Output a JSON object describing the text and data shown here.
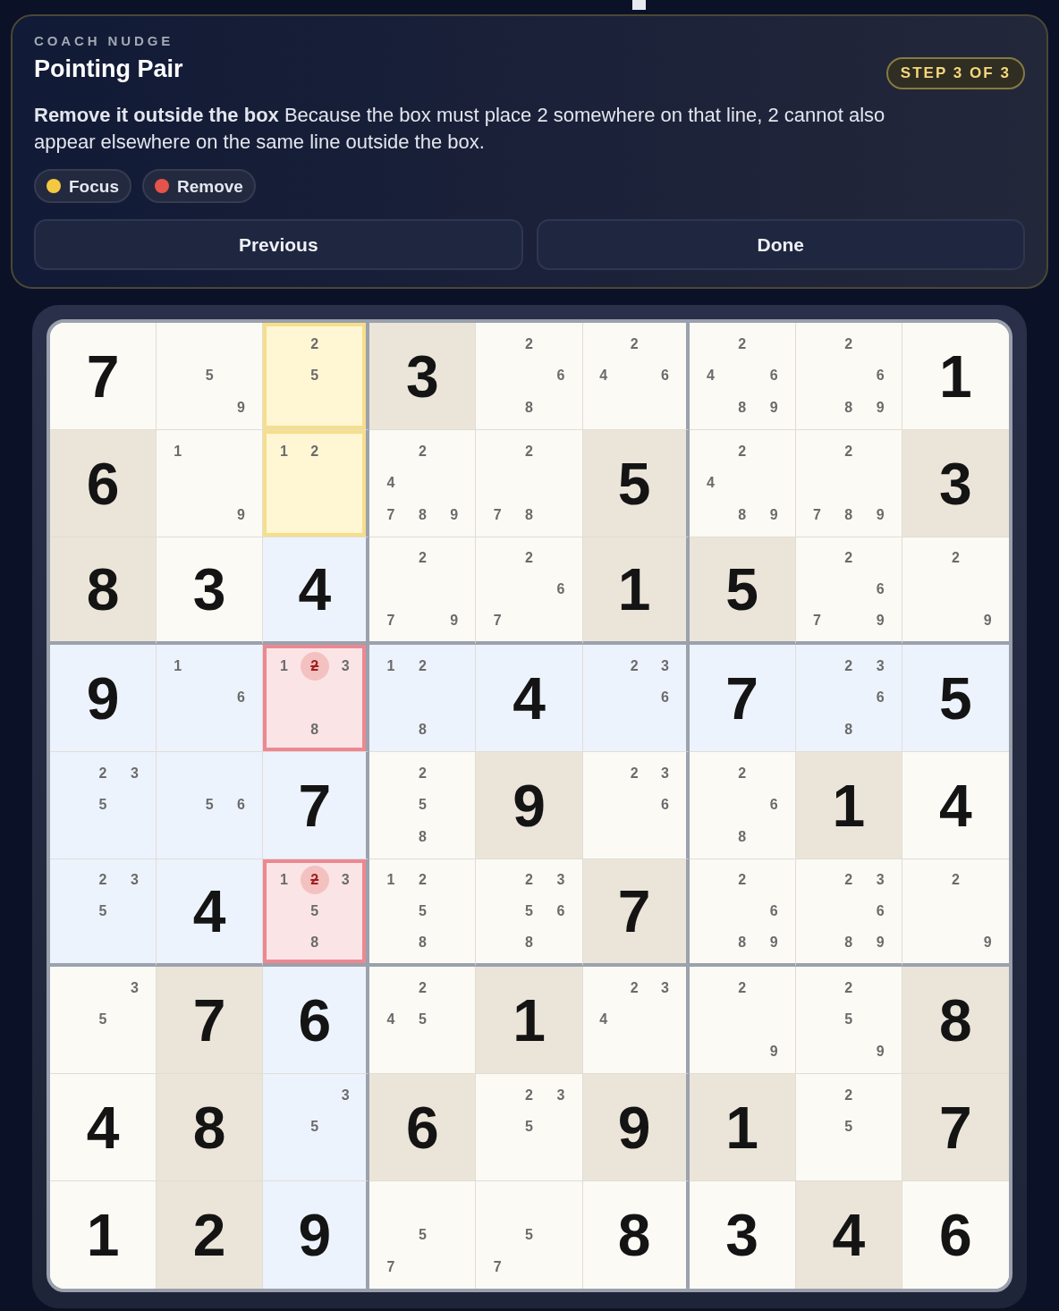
{
  "header": {
    "eyebrow": "COACH NUDGE",
    "title": "Pointing Pair",
    "step_badge": "STEP 3 OF 3"
  },
  "message": "**Remove it outside the box** Because the box must place 2 somewhere on that line, 2 cannot also appear elsewhere on the same line outside the box.",
  "legend": [
    {
      "label": "Focus",
      "color": "#f5c842"
    },
    {
      "label": "Remove",
      "color": "#e5534b"
    }
  ],
  "buttons": [
    {
      "label": "Previous"
    },
    {
      "label": "Done"
    }
  ],
  "board": {
    "rows": [
      [
        {
          "value": "7",
          "kind": "plain"
        },
        {
          "notes": [
            "5",
            "9"
          ],
          "kind": "plain"
        },
        {
          "notes": [
            "2",
            "5"
          ],
          "kind": "focus"
        },
        {
          "value": "3",
          "kind": "given"
        },
        {
          "notes": [
            "2",
            "6",
            "8"
          ],
          "kind": "plain"
        },
        {
          "notes": [
            "2",
            "4",
            "6"
          ],
          "kind": "plain"
        },
        {
          "notes": [
            "2",
            "4",
            "6",
            "8",
            "9"
          ],
          "kind": "plain"
        },
        {
          "notes": [
            "2",
            "6",
            "8",
            "9"
          ],
          "kind": "plain"
        },
        {
          "value": "1",
          "kind": "plain"
        }
      ],
      [
        {
          "value": "6",
          "kind": "given"
        },
        {
          "notes": [
            "1",
            "9"
          ],
          "kind": "plain"
        },
        {
          "notes": [
            "1",
            "2"
          ],
          "kind": "focus"
        },
        {
          "notes": [
            "2",
            "4",
            "7",
            "8",
            "9"
          ],
          "kind": "plain"
        },
        {
          "notes": [
            "2",
            "7",
            "8"
          ],
          "kind": "plain"
        },
        {
          "value": "5",
          "kind": "given"
        },
        {
          "notes": [
            "2",
            "4",
            "8",
            "9"
          ],
          "kind": "plain"
        },
        {
          "notes": [
            "2",
            "7",
            "8",
            "9"
          ],
          "kind": "plain"
        },
        {
          "value": "3",
          "kind": "given"
        }
      ],
      [
        {
          "value": "8",
          "kind": "given"
        },
        {
          "value": "3",
          "kind": "plain"
        },
        {
          "value": "4",
          "kind": "peer"
        },
        {
          "notes": [
            "2",
            "7",
            "9"
          ],
          "kind": "plain"
        },
        {
          "notes": [
            "2",
            "6",
            "7"
          ],
          "kind": "plain"
        },
        {
          "value": "1",
          "kind": "given"
        },
        {
          "value": "5",
          "kind": "given"
        },
        {
          "notes": [
            "2",
            "6",
            "7",
            "9"
          ],
          "kind": "plain"
        },
        {
          "notes": [
            "2",
            "9"
          ],
          "kind": "plain"
        }
      ],
      [
        {
          "value": "9",
          "kind": "peer"
        },
        {
          "notes": [
            "1",
            "6"
          ],
          "kind": "peer"
        },
        {
          "notes": [
            "1",
            "3",
            "8"
          ],
          "struck_notes": [
            "2"
          ],
          "kind": "remove"
        },
        {
          "notes": [
            "1",
            "2",
            "8"
          ],
          "kind": "peer"
        },
        {
          "value": "4",
          "kind": "peer"
        },
        {
          "notes": [
            "2",
            "3",
            "6"
          ],
          "kind": "peer"
        },
        {
          "value": "7",
          "kind": "peer"
        },
        {
          "notes": [
            "2",
            "3",
            "6",
            "8"
          ],
          "kind": "peer"
        },
        {
          "value": "5",
          "kind": "peer"
        }
      ],
      [
        {
          "notes": [
            "2",
            "3",
            "5"
          ],
          "kind": "peer"
        },
        {
          "notes": [
            "5",
            "6"
          ],
          "kind": "peer"
        },
        {
          "value": "7",
          "kind": "peer"
        },
        {
          "notes": [
            "2",
            "5",
            "8"
          ],
          "kind": "plain"
        },
        {
          "value": "9",
          "kind": "given"
        },
        {
          "notes": [
            "2",
            "3",
            "6"
          ],
          "kind": "plain"
        },
        {
          "notes": [
            "2",
            "6",
            "8"
          ],
          "kind": "plain"
        },
        {
          "value": "1",
          "kind": "given"
        },
        {
          "value": "4",
          "kind": "plain"
        }
      ],
      [
        {
          "notes": [
            "2",
            "3",
            "5"
          ],
          "kind": "peer"
        },
        {
          "value": "4",
          "kind": "peer"
        },
        {
          "notes": [
            "1",
            "3",
            "5",
            "8"
          ],
          "struck_notes": [
            "2"
          ],
          "kind": "remove"
        },
        {
          "notes": [
            "1",
            "2",
            "5",
            "8"
          ],
          "kind": "plain"
        },
        {
          "notes": [
            "2",
            "3",
            "5",
            "6",
            "8"
          ],
          "kind": "plain"
        },
        {
          "value": "7",
          "kind": "given"
        },
        {
          "notes": [
            "2",
            "6",
            "8",
            "9"
          ],
          "kind": "plain"
        },
        {
          "notes": [
            "2",
            "3",
            "6",
            "8",
            "9"
          ],
          "kind": "plain"
        },
        {
          "notes": [
            "2",
            "9"
          ],
          "kind": "plain"
        }
      ],
      [
        {
          "notes": [
            "3",
            "5"
          ],
          "kind": "plain"
        },
        {
          "value": "7",
          "kind": "given"
        },
        {
          "value": "6",
          "kind": "peer"
        },
        {
          "notes": [
            "2",
            "4",
            "5"
          ],
          "kind": "plain"
        },
        {
          "value": "1",
          "kind": "given"
        },
        {
          "notes": [
            "2",
            "3",
            "4"
          ],
          "kind": "plain"
        },
        {
          "notes": [
            "2",
            "9"
          ],
          "kind": "plain"
        },
        {
          "notes": [
            "2",
            "5",
            "9"
          ],
          "kind": "plain"
        },
        {
          "value": "8",
          "kind": "given"
        }
      ],
      [
        {
          "value": "4",
          "kind": "plain"
        },
        {
          "value": "8",
          "kind": "given"
        },
        {
          "notes": [
            "3",
            "5"
          ],
          "kind": "peer"
        },
        {
          "value": "6",
          "kind": "given"
        },
        {
          "notes": [
            "2",
            "3",
            "5"
          ],
          "kind": "plain"
        },
        {
          "value": "9",
          "kind": "given"
        },
        {
          "value": "1",
          "kind": "given"
        },
        {
          "notes": [
            "2",
            "5"
          ],
          "kind": "plain"
        },
        {
          "value": "7",
          "kind": "given"
        }
      ],
      [
        {
          "value": "1",
          "kind": "plain"
        },
        {
          "value": "2",
          "kind": "given"
        },
        {
          "value": "9",
          "kind": "peer"
        },
        {
          "notes": [
            "5",
            "7"
          ],
          "kind": "plain"
        },
        {
          "notes": [
            "5",
            "7"
          ],
          "kind": "plain"
        },
        {
          "value": "8",
          "kind": "plain"
        },
        {
          "value": "3",
          "kind": "plain"
        },
        {
          "value": "4",
          "kind": "given"
        },
        {
          "value": "6",
          "kind": "plain"
        }
      ]
    ]
  }
}
